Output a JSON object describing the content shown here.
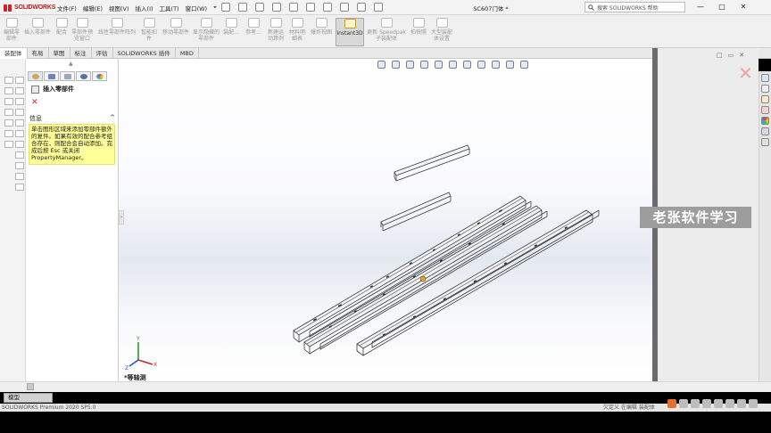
{
  "app": {
    "brand": "SOLIDWORKS",
    "document_title": "SC607门体 *"
  },
  "menu": [
    "文件(F)",
    "编辑(E)",
    "视图(V)",
    "插入(I)",
    "工具(T)",
    "窗口(W)",
    "⌖"
  ],
  "search": {
    "label": "搜索 SOLIDWORKS 帮助",
    "icon": "search-icon"
  },
  "window_controls": [
    "—",
    "□",
    "✕"
  ],
  "commands": [
    {
      "id": "edit-component",
      "label": "编辑零部件"
    },
    {
      "id": "insert-component",
      "label": "插入零部件"
    },
    {
      "id": "mate",
      "label": "配合"
    },
    {
      "id": "component-preview",
      "label": "零部件预览窗口"
    },
    {
      "id": "linear-pattern",
      "label": "线性零部件阵列"
    },
    {
      "id": "smart-fasteners",
      "label": "智能扣件"
    },
    {
      "id": "move-component",
      "label": "移动零部件"
    },
    {
      "id": "show-hidden",
      "label": "显示隐藏的零部件"
    },
    {
      "id": "assembly-features",
      "label": "装配..."
    },
    {
      "id": "reference",
      "label": "参考..."
    },
    {
      "id": "new-motion-study",
      "label": "新建运动算例"
    },
    {
      "id": "bom",
      "label": "材料明细表"
    },
    {
      "id": "exploded-view",
      "label": "爆炸视图"
    },
    {
      "id": "instant3d",
      "label": "Instant3D"
    },
    {
      "id": "update-speedpak",
      "label": "更新 Speedpak 子装配体"
    },
    {
      "id": "snapshot",
      "label": "拍快照"
    },
    {
      "id": "large-assembly",
      "label": "大型装配体设置"
    }
  ],
  "tabs": [
    "装配体",
    "布局",
    "草图",
    "标注",
    "评估",
    "SOLIDWORKS 插件",
    "MBD"
  ],
  "property_manager": {
    "title": "插入零部件",
    "close": "✕",
    "message_header": "信息",
    "collapse": "^",
    "message": "单击图形区域来添加零部件额外的复件。如果有效的配合参考组合存在，则配合会自动添加。完成后按 Esc 或关闭 PropertyManager。"
  },
  "graphics": {
    "view_orientation": "*等轴测",
    "axes": {
      "x": "X",
      "y": "Y",
      "z": "Z"
    }
  },
  "watermark": "老张软件学习",
  "model_tab": "模型",
  "status": {
    "left": "SOLIDWORKS Premium 2020 SP5.0",
    "right": "欠定义    在编辑 装配体"
  },
  "colors": {
    "brand_red": "#d81e1e",
    "message_bg": "#ffff9a",
    "watermark_bg": "#9d9d9d",
    "part_line": "#3c3c3c"
  }
}
